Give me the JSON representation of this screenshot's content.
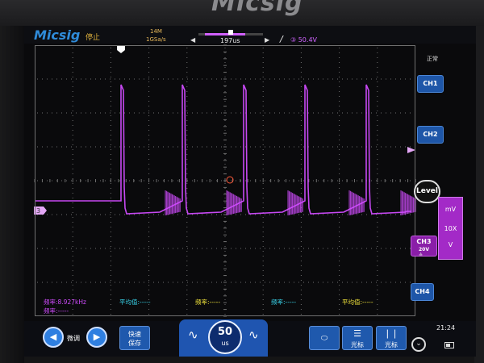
{
  "bezel": {
    "brand": "Micsig"
  },
  "status": {
    "logo": "Micsig",
    "run_state": "停止",
    "memory_depth": "14M",
    "sample_rate": "1GSa/s",
    "timebase_position": "197us",
    "trigger_channel_level": "③ 50.4V"
  },
  "side_panel": {
    "mode": "正常",
    "ch1": "CH1",
    "ch2": "CH2",
    "level": "Level",
    "ch3": "CH3",
    "ch3_scale": "20V",
    "ch3_coupling": "≙",
    "ch4": "CH4",
    "vertical_unit": {
      "top": "mV",
      "mid": "10X",
      "bottom": "V"
    }
  },
  "channel_marker": "3",
  "trigger_marker": "T",
  "measurements": [
    {
      "label": "频率:8.927kHz",
      "color": "#d14cff"
    },
    {
      "label": "频率:-----",
      "color": "#d14cff"
    },
    {
      "label": "平均值:-----",
      "color": "#39d7ee"
    },
    {
      "label": "频率:-----",
      "color": "#f0e33a"
    },
    {
      "label": "频率:-----",
      "color": "#39d7ee"
    },
    {
      "label": "平均值:-----",
      "color": "#f0e33a"
    }
  ],
  "bottom": {
    "fine_label": "微调",
    "quick_save_1": "快速",
    "quick_save_2": "保存",
    "timebase_value": "50",
    "timebase_unit": "us",
    "cursor_label": "光标",
    "cursor2_label": "光标",
    "clock": "21:24"
  },
  "colors": {
    "ch3": "#d14cff",
    "grid": "#6f6f6f",
    "accent_blue": "#1f59ad"
  }
}
